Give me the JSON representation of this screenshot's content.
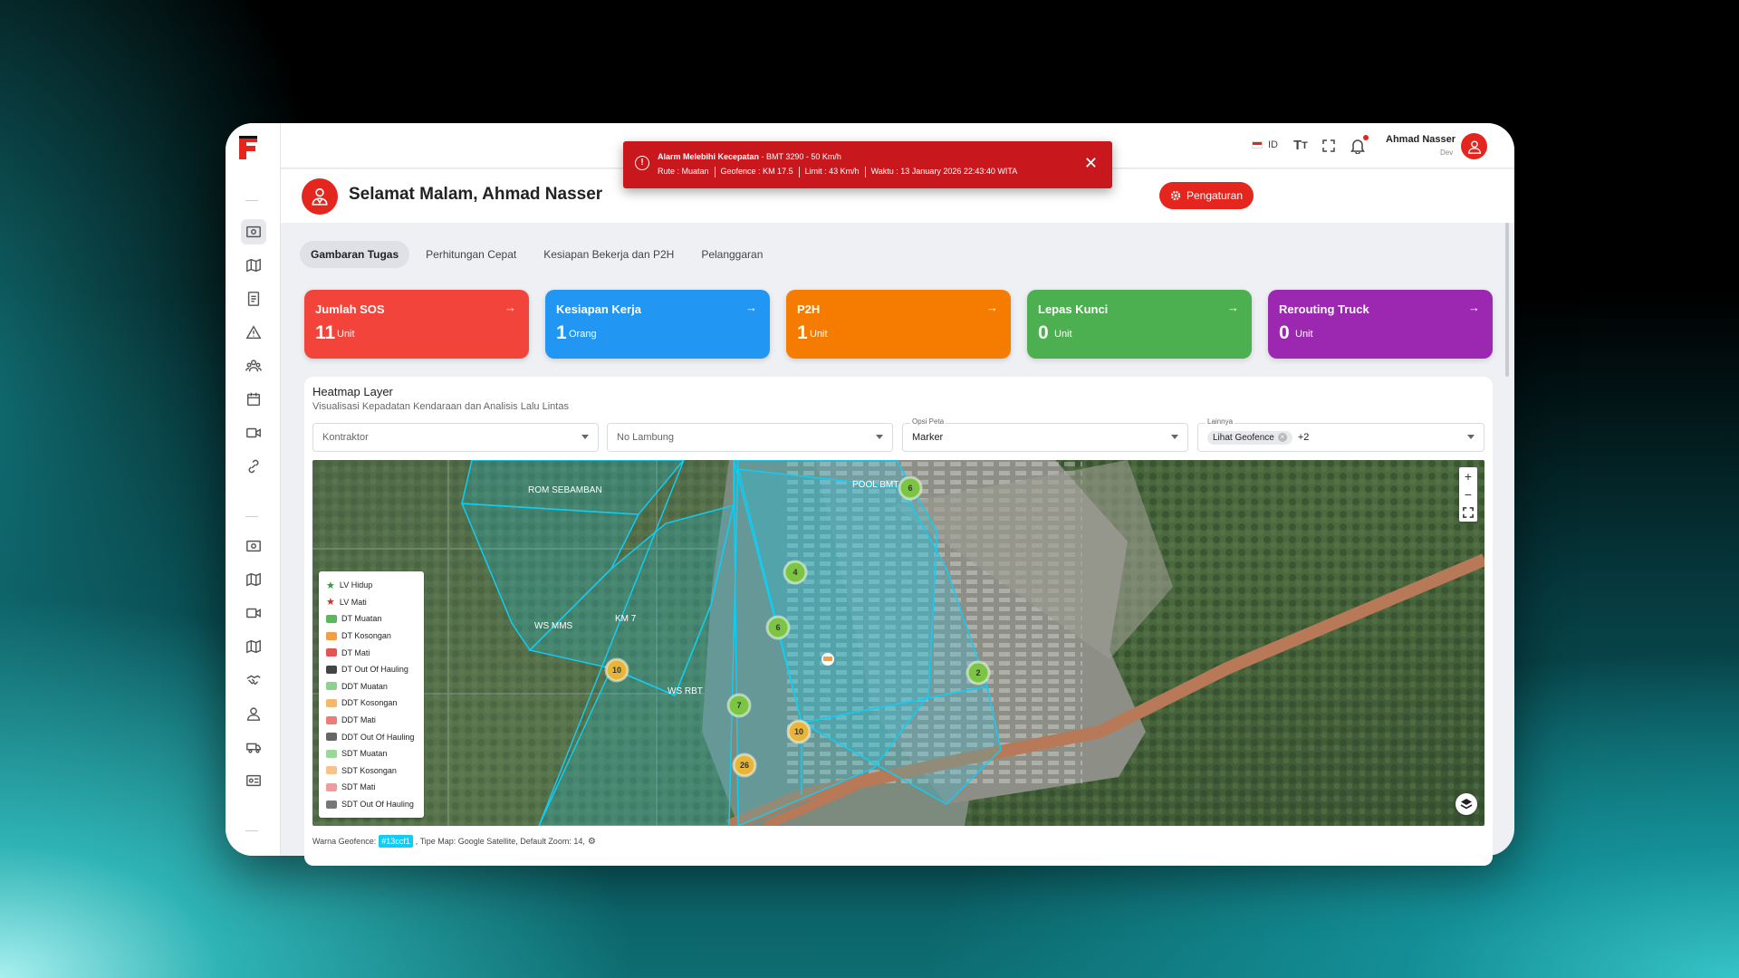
{
  "app": {
    "logo": "F"
  },
  "alarm": {
    "title": "Alarm Melebihi Kecepatan",
    "vehicle": "BMT 3290 - 50 Km/h",
    "rute": "Rute : Muatan",
    "geofence": "Geofence : KM 17.5",
    "limit": "Limit : 43 Km/h",
    "waktu": "Waktu : 13 January 2026 22:43:40 WITA"
  },
  "topbar": {
    "language": "ID",
    "user_name": "Ahmad Nasser",
    "user_role": "Dev"
  },
  "greeting": {
    "title": "Selamat Malam, Ahmad Nasser",
    "settings_label": "Pengaturan"
  },
  "tabs": [
    {
      "label": "Gambaran Tugas",
      "active": true
    },
    {
      "label": "Perhitungan Cepat",
      "active": false
    },
    {
      "label": "Kesiapan Bekerja dan P2H",
      "active": false
    },
    {
      "label": "Pelanggaran",
      "active": false
    }
  ],
  "cards": [
    {
      "title": "Jumlah SOS",
      "value": "11",
      "unit": "Unit",
      "color": "#f2443a"
    },
    {
      "title": "Kesiapan Kerja",
      "value": "1",
      "unit": "Orang",
      "color": "#2196f3"
    },
    {
      "title": "P2H",
      "value": "1",
      "unit": "Unit",
      "color": "#f57c00"
    },
    {
      "title": "Lepas Kunci",
      "value": "0",
      "unit": "Unit",
      "color": "#4caf50"
    },
    {
      "title": "Rerouting Truck",
      "value": "0",
      "unit": "Unit",
      "color": "#9c27b0"
    }
  ],
  "heatmap": {
    "title": "Heatmap Layer",
    "subtitle": "Visualisasi Kepadatan Kendaraan dan Analisis Lalu Lintas",
    "filters": {
      "kontraktor_placeholder": "Kontraktor",
      "lambung_placeholder": "No Lambung",
      "opsi_label": "Opsi Peta",
      "opsi_value": "Marker",
      "lainnya_label": "Lainnya",
      "lainnya_chip": "Lihat Geofence",
      "lainnya_more": "+2"
    },
    "map_labels": {
      "rom": "ROM SEBAMBAN",
      "pool": "POOL BMT",
      "km7": "KM 7",
      "wsmms": "WS MMS",
      "wsrbt": "WS RBT"
    },
    "clusters": [
      {
        "count": "6",
        "color": "#7cc444"
      },
      {
        "count": "4",
        "color": "#7cc444"
      },
      {
        "count": "6",
        "color": "#7cc444"
      },
      {
        "count": "2",
        "color": "#7cc444"
      },
      {
        "count": "7",
        "color": "#7cc444"
      },
      {
        "count": "10",
        "color": "#e6b53a"
      },
      {
        "count": "10",
        "color": "#e6b53a"
      },
      {
        "count": "26",
        "color": "#e6b53a"
      }
    ],
    "legend": [
      {
        "label": "LV Hidup",
        "color": "#2e9b3a"
      },
      {
        "label": "LV Mati",
        "color": "#d62b2b"
      },
      {
        "label": "DT Muatan",
        "color": "#5cb85c"
      },
      {
        "label": "DT Kosongan",
        "color": "#f0a040"
      },
      {
        "label": "DT Mati",
        "color": "#e55353"
      },
      {
        "label": "DT Out Of Hauling",
        "color": "#444444"
      },
      {
        "label": "DDT Muatan",
        "color": "#8fd18f"
      },
      {
        "label": "DDT Kosongan",
        "color": "#f5b76b"
      },
      {
        "label": "DDT Mati",
        "color": "#ef7a7a"
      },
      {
        "label": "DDT Out Of Hauling",
        "color": "#666666"
      },
      {
        "label": "SDT Muatan",
        "color": "#9ad79a"
      },
      {
        "label": "SDT Kosongan",
        "color": "#f7c38a"
      },
      {
        "label": "SDT Mati",
        "color": "#f29b9b"
      },
      {
        "label": "SDT Out Of Hauling",
        "color": "#777777"
      }
    ],
    "footer": {
      "prefix": "Warna Geofence:",
      "color_chip": "#13ccf1",
      "rest": ", Tipe Map: Google Satellite, Default Zoom: 14,"
    }
  }
}
